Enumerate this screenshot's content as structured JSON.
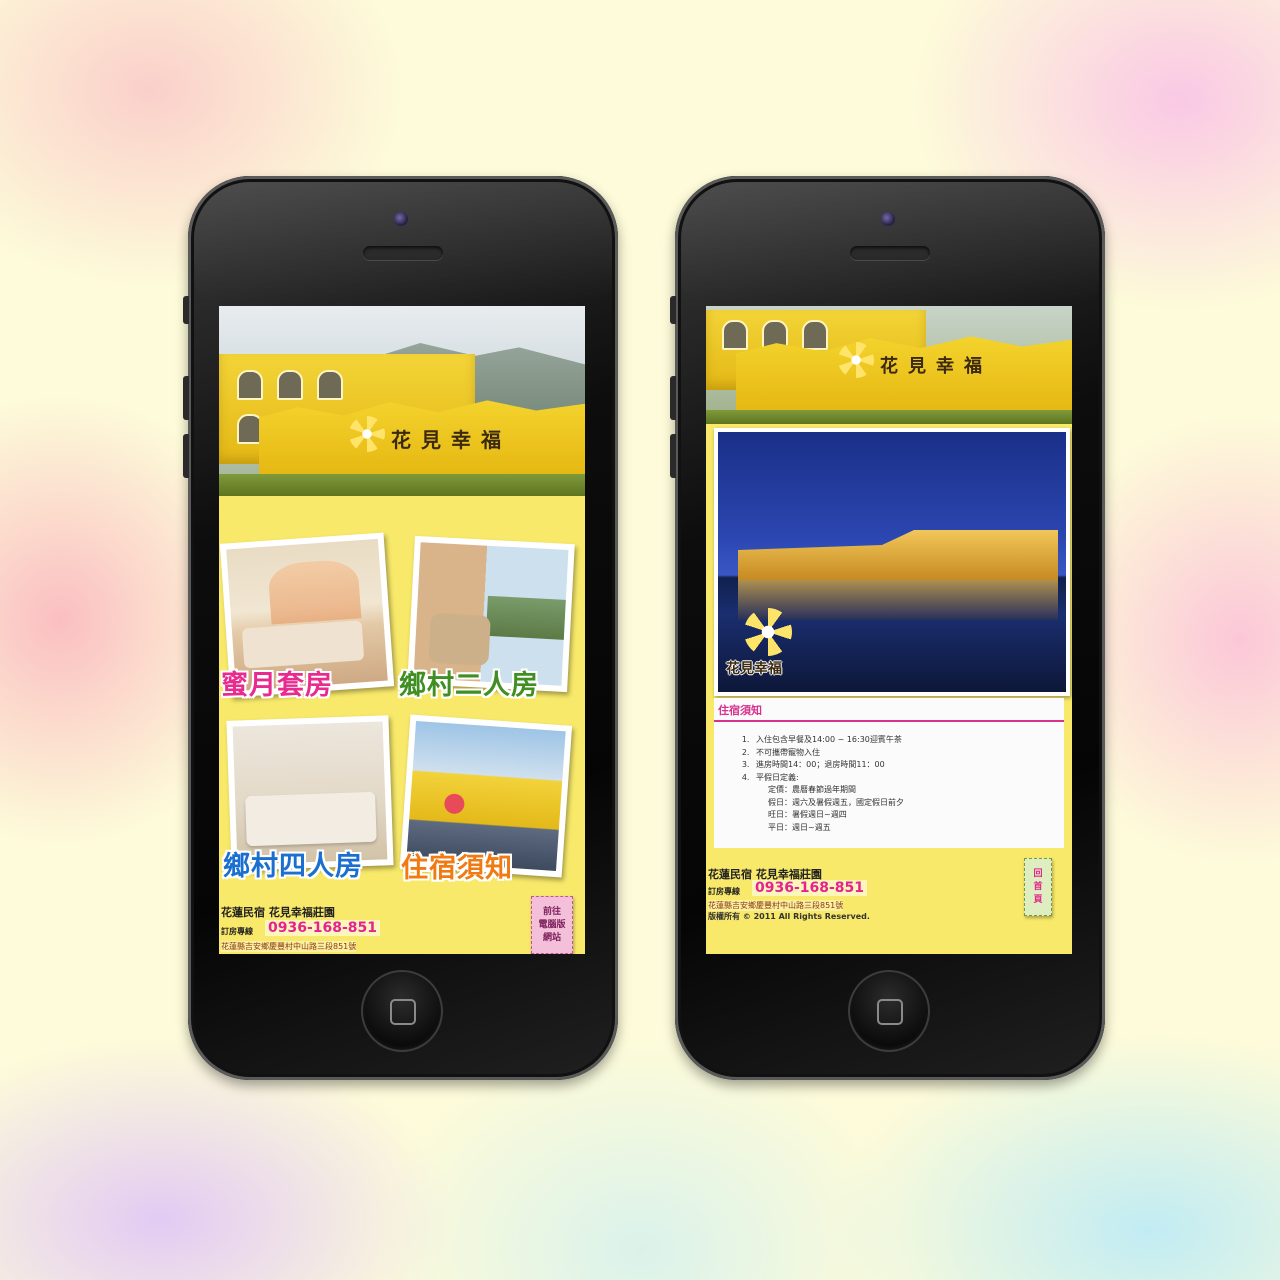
{
  "left_screen": {
    "sign_text": "花見幸福",
    "rooms": [
      {
        "label": "蜜月套房",
        "color": "#e92a8e"
      },
      {
        "label": "鄉村二人房",
        "color": "#3f8f22"
      },
      {
        "label": "鄉村四人房",
        "color": "#1b6fd0"
      },
      {
        "label": "住宿須知",
        "color": "#f07b12"
      }
    ],
    "footer": {
      "title": "花蓮民宿 花見幸福莊園",
      "hotline_label": "訂房專線",
      "phone": "0936-168-851",
      "address": "花蓮縣吉安鄉慶豐村中山路三段851號",
      "sticker": "前往\n電腦版\n網站"
    }
  },
  "right_screen": {
    "sign_text": "花見幸福",
    "photo_caption": "花見幸福",
    "notice": {
      "title": "住宿須知",
      "items": [
        "入住包含早餐及14:00 ~ 16:30迎賓午茶",
        "不可攜帶寵物入住",
        "進房時間14：00；退房時間11：00",
        "平假日定義:"
      ],
      "sub_items": [
        "定價：農曆春節過年期間",
        "假日：週六及暑假週五，國定假日前夕",
        "旺日：暑假週日~週四",
        "平日：週日~週五"
      ]
    },
    "footer": {
      "title": "花蓮民宿 花見幸福莊園",
      "hotline_label": "訂房專線",
      "phone": "0936-168-851",
      "address": "花蓮縣吉安鄉慶豐村中山路三段851號",
      "copyright": "版權所有 © 2011 All Rights Reserved.",
      "sticker": "回\n首\n頁"
    }
  },
  "colors": {
    "screen_bg": "#f8e96a",
    "accent_pink": "#e5228d",
    "notice_rule": "#d6338f"
  }
}
